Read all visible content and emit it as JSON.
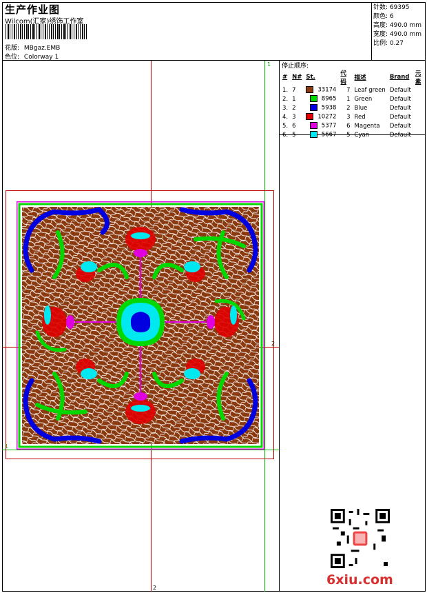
{
  "header": {
    "title": "生产作业图",
    "subtitle": "Wilcom(汇家)绣饰工作室",
    "design_label": "花版:",
    "design_value": "MBgaz.EMB",
    "colorway_label": "色位:",
    "colorway_value": "Colorway 1"
  },
  "stats": {
    "stitches": "针数: 69395",
    "colors": "颜色: 6",
    "height": "高度: 490.0 mm",
    "width": "宽度: 490.0 mm",
    "scale": "比例: 0.27"
  },
  "stop_sequence": {
    "title": "停止顺序:",
    "headers": [
      "#",
      "N#",
      "St.",
      "代码",
      "描述",
      "Brand",
      "元素"
    ],
    "rows": [
      {
        "idx": "1.",
        "n": "7",
        "color": "#8b3a10",
        "st": "33174",
        "code": "7",
        "desc": "Leaf green",
        "brand": "Default"
      },
      {
        "idx": "2.",
        "n": "1",
        "color": "#00d800",
        "st": "8965",
        "code": "1",
        "desc": "Green",
        "brand": "Default"
      },
      {
        "idx": "3.",
        "n": "2",
        "color": "#0000e0",
        "st": "5938",
        "code": "2",
        "desc": "Blue",
        "brand": "Default"
      },
      {
        "idx": "4.",
        "n": "3",
        "color": "#e00000",
        "st": "10272",
        "code": "3",
        "desc": "Red",
        "brand": "Default"
      },
      {
        "idx": "5.",
        "n": "6",
        "color": "#e000e0",
        "st": "5377",
        "code": "6",
        "desc": "Magenta",
        "brand": "Default"
      },
      {
        "idx": "6.",
        "n": "5",
        "color": "#00e8f0",
        "st": "5667",
        "code": "5",
        "desc": "Cyan",
        "brand": "Default"
      }
    ]
  },
  "axis_labels": {
    "top_right": "1",
    "right_mid": "2",
    "bottom_mid": "2",
    "left_mid": "1"
  },
  "watermark": "6xiu.com",
  "colors": {
    "brown": "#8b3a10",
    "green": "#00d800",
    "blue": "#0000e0",
    "red": "#e00000",
    "magenta": "#e000e0",
    "cyan": "#00e8f0",
    "guide_red": "#c00000",
    "guide_green": "#00c000"
  }
}
